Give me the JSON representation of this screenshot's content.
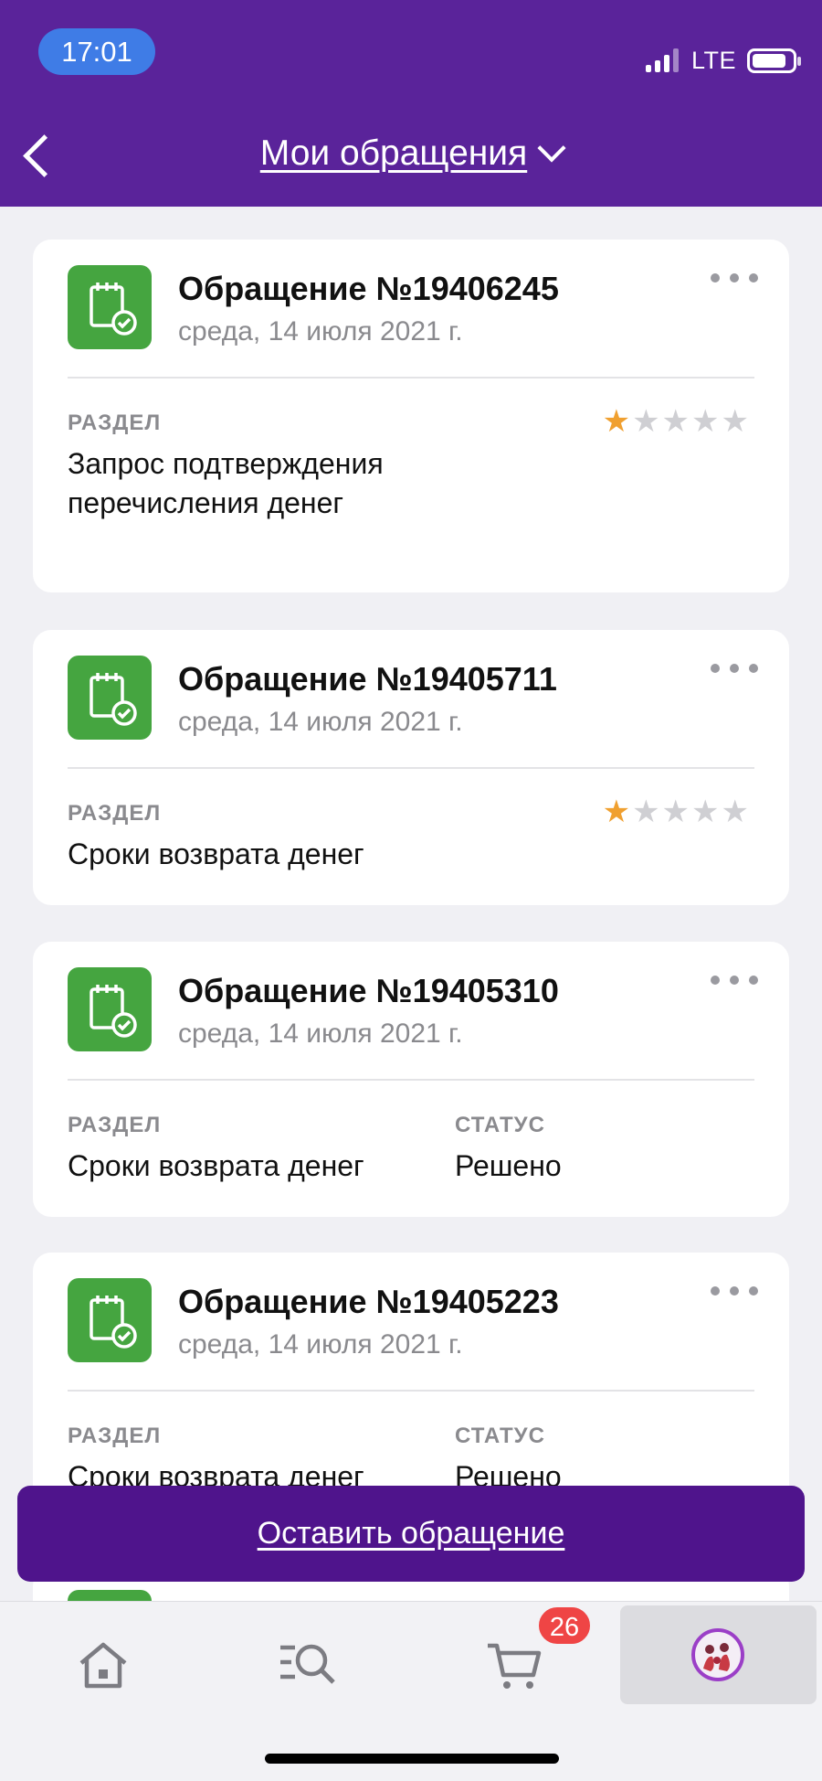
{
  "status_bar": {
    "time": "17:01",
    "network": "LTE"
  },
  "header": {
    "title": "Мои обращения"
  },
  "tickets": [
    {
      "title": "Обращение №19406245",
      "date": "среда, 14 июля 2021 г.",
      "section_label": "РАЗДЕЛ",
      "section": "Запрос подтверждения перечисления денег",
      "rating": 1,
      "rating_max": 5
    },
    {
      "title": "Обращение №19405711",
      "date": "среда, 14 июля 2021 г.",
      "section_label": "РАЗДЕЛ",
      "section": "Сроки возврата денег",
      "rating": 1,
      "rating_max": 5
    },
    {
      "title": "Обращение №19405310",
      "date": "среда, 14 июля 2021 г.",
      "section_label": "РАЗДЕЛ",
      "section": "Сроки возврата денег",
      "status_label": "СТАТУС",
      "status": "Решено"
    },
    {
      "title": "Обращение №19405223",
      "date": "среда, 14 июля 2021 г.",
      "section_label": "РАЗДЕЛ",
      "section": "Сроки возврата денег",
      "status_label": "СТАТУС",
      "status": "Решено"
    }
  ],
  "actions": {
    "new_ticket": "Оставить обращение"
  },
  "tabbar": {
    "items": [
      {
        "icon": "home-icon"
      },
      {
        "icon": "catalog-search-icon"
      },
      {
        "icon": "cart-icon",
        "badge": "26"
      },
      {
        "icon": "profile-avatar-icon",
        "active": true
      }
    ]
  },
  "colors": {
    "header": "#5a239a",
    "button": "#4f148c",
    "icon_green": "#45a540",
    "star_on": "#f0a030",
    "badge": "#ef4545"
  }
}
